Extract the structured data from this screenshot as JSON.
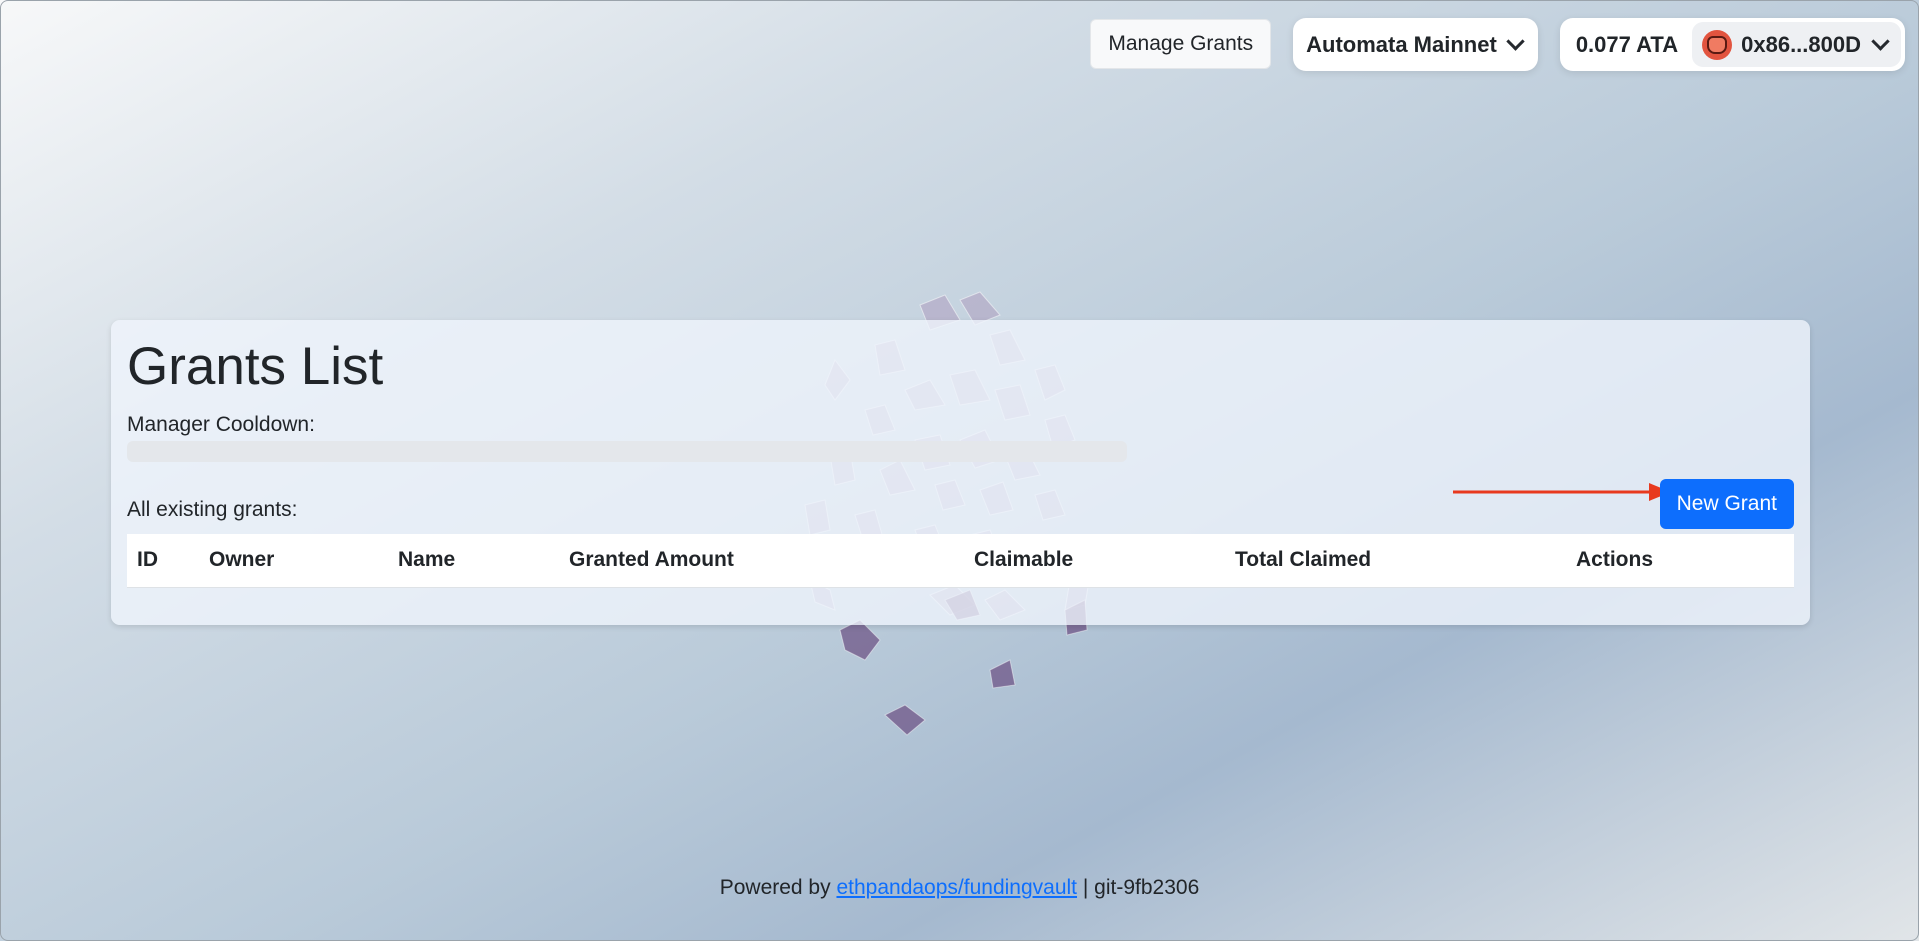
{
  "header": {
    "manage_grants_label": "Manage Grants",
    "network_label": "Automata Mainnet",
    "balance": "0.077 ATA",
    "account_address": "0x86...800D"
  },
  "grants_card": {
    "title": "Grants List",
    "cooldown_label": "Manager Cooldown:",
    "cooldown_progress_percent": 0,
    "existing_grants_label": "All existing grants:",
    "new_grant_button_label": "New Grant",
    "table": {
      "columns": [
        "ID",
        "Owner",
        "Name",
        "Granted Amount",
        "Claimable",
        "Total Claimed",
        "Actions"
      ],
      "rows": []
    }
  },
  "footer": {
    "powered_by_text": "Powered by",
    "repo_link_text": "ethpandaops/fundingvault",
    "separator": "|",
    "git_version": "git-9fb2306"
  },
  "colors": {
    "primary_button": "#0d6efd",
    "annotation_arrow": "#e8391e",
    "crystal": "#9b86a8"
  }
}
